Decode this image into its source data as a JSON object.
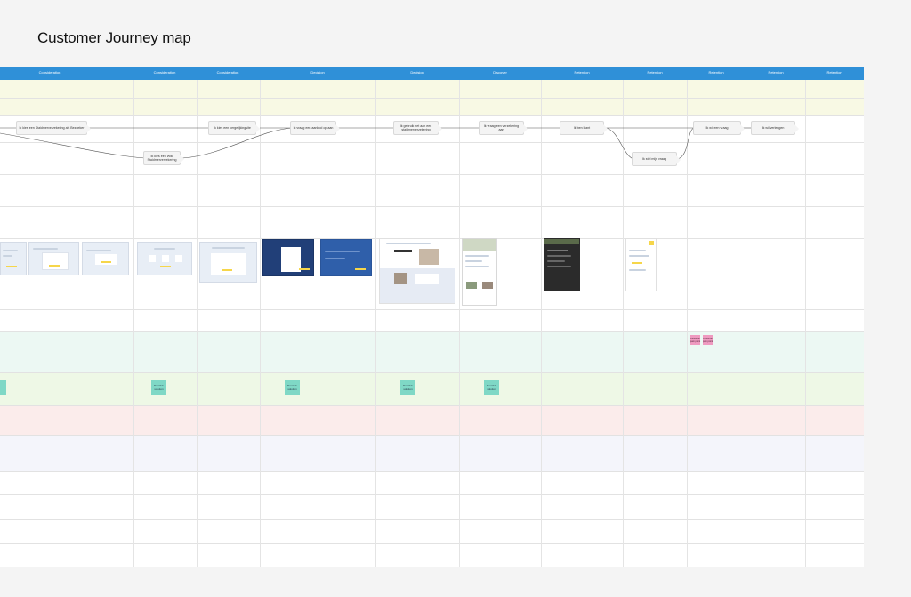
{
  "title": "Customer Journey map",
  "colors": {
    "header": "#2f90d8",
    "band_yellow": "#f8f9e4",
    "band_mint": "#ecf8f3",
    "band_green": "#eef8e6",
    "band_red": "#fbeceb",
    "band_lavender": "#f4f5fb"
  },
  "stages": [
    {
      "label": "Consideration"
    },
    {
      "label": "Consideration"
    },
    {
      "label": "Consideration"
    },
    {
      "label": "Decision"
    },
    {
      "label": "Decision"
    },
    {
      "label": "Discover"
    },
    {
      "label": "Retention"
    },
    {
      "label": "Retention"
    },
    {
      "label": "Retention"
    },
    {
      "label": "Retention"
    },
    {
      "label": "Retention"
    }
  ],
  "journey_steps": [
    {
      "label": "Ik kies een Staidmerverzekering als Bezoeker"
    },
    {
      "label": "Ik kies een Wiki Staidmerverzekering"
    },
    {
      "label": "Ik kies een vergelijkingsite"
    },
    {
      "label": "Ik vraag een aanbod op aan"
    },
    {
      "label": "Ik gebruik het aan een staidmerverzekering"
    },
    {
      "label": "Ik vraag een verzekering aan"
    },
    {
      "label": "Ik ben klant"
    },
    {
      "label": "Ik stel mijn vraag"
    },
    {
      "label": "Ik wil een vraag"
    },
    {
      "label": "Ik wil verlengen"
    }
  ],
  "stickies": [
    {
      "label": "Possible solution"
    },
    {
      "label": "Possible solution"
    },
    {
      "label": "Possible solution"
    },
    {
      "label": "Possible solution"
    },
    {
      "label": "Possible solution"
    }
  ],
  "pink_notes": [
    {
      "label": "Customer pain point"
    },
    {
      "label": "Customer pain point"
    }
  ],
  "screenshots": [
    {
      "name": "screen-1"
    },
    {
      "name": "screen-2"
    },
    {
      "name": "screen-3"
    },
    {
      "name": "screen-4"
    },
    {
      "name": "screen-5"
    },
    {
      "name": "screen-6"
    },
    {
      "name": "screen-7"
    },
    {
      "name": "screen-8"
    },
    {
      "name": "screen-9"
    },
    {
      "name": "screen-10"
    },
    {
      "name": "screen-11"
    }
  ]
}
